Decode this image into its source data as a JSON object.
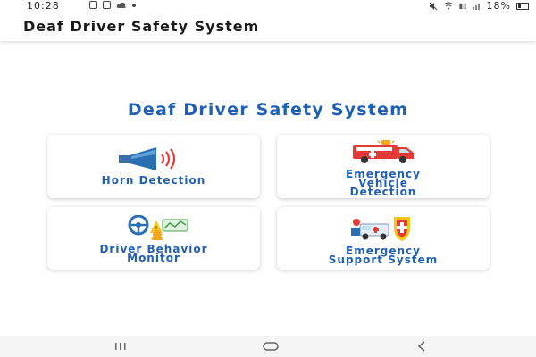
{
  "status_bar": {
    "time": "10:28",
    "battery": "18%",
    "icons": [
      "message-icon",
      "image-icon",
      "cloud-icon",
      "dot-icon",
      "mute-icon",
      "wifi-icon",
      "volte-icon",
      "signal-icon",
      "battery-icon"
    ]
  },
  "app_bar": {
    "title": "Deaf Driver Safety System"
  },
  "main": {
    "heading": "Deaf Driver Safety System",
    "cards": [
      {
        "label": "Horn Detection",
        "icon": "horn-speaker-icon"
      },
      {
        "label": "Emergency\nVehicle\nDetection",
        "icon": "ambulance-icon"
      },
      {
        "label": "Driver Behavior\nMonitor",
        "icon": "steering-wheel-icon"
      },
      {
        "label": "Emergency\nSupport System",
        "icon": "ambulance-shield-icon"
      }
    ]
  },
  "nav_bar": {
    "buttons": [
      "recent-apps-icon",
      "home-icon",
      "back-icon"
    ]
  },
  "colors": {
    "accent": "#1f5fb4",
    "horn_blue": "#2a6fb0",
    "sound_red": "#e53935",
    "ambulance_red": "#e53935",
    "shield_yellow": "#f5c518"
  }
}
